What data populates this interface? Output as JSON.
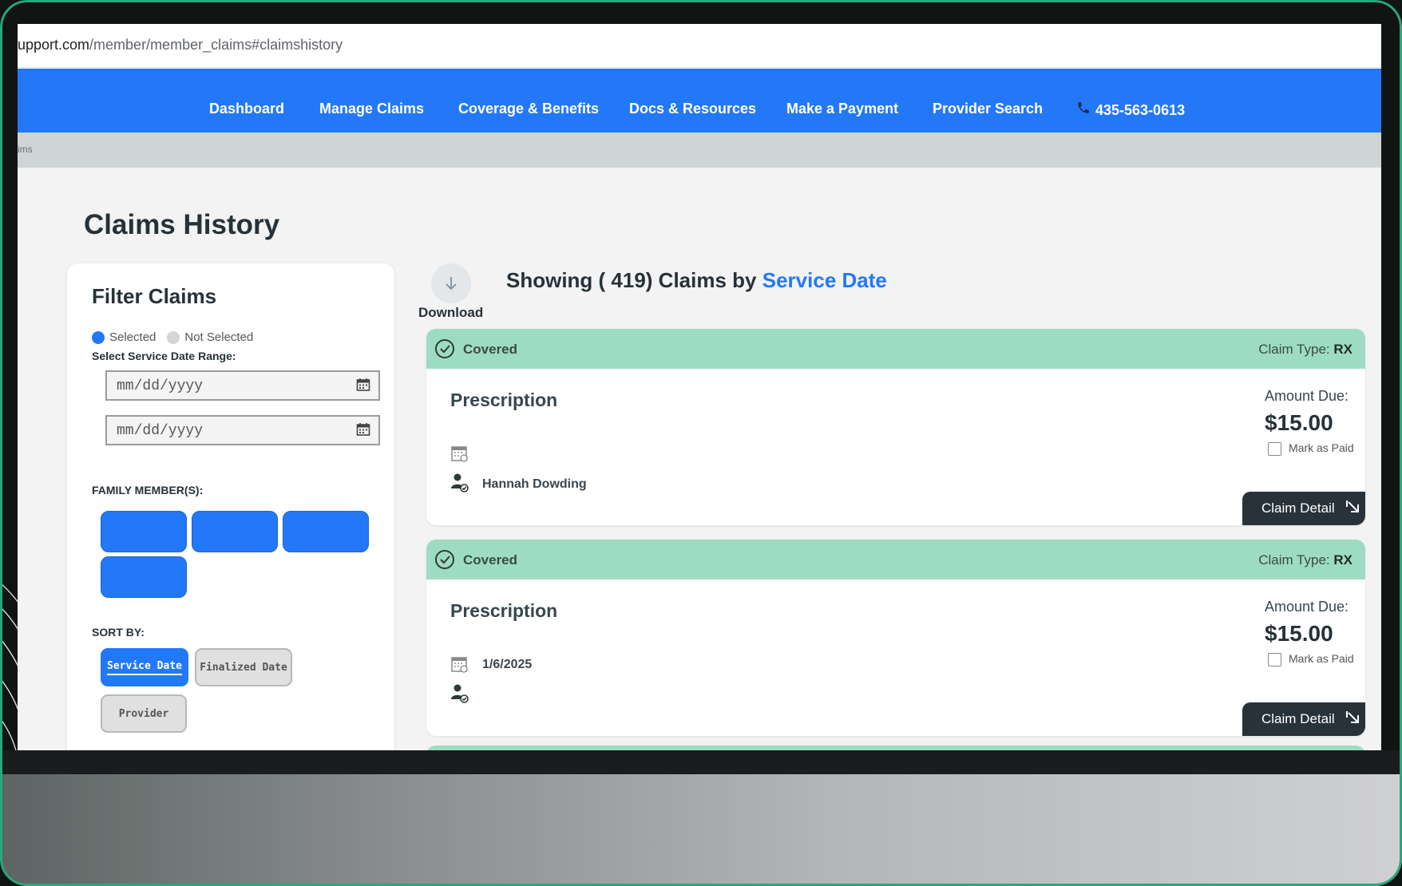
{
  "browser": {
    "url_domain": "upport.com",
    "url_path": "/member/member_claims#claimshistory"
  },
  "nav": {
    "items": [
      "Dashboard",
      "Manage Claims",
      "Coverage & Benefits",
      "Docs & Resources",
      "Make a Payment",
      "Provider Search"
    ],
    "phone": "435-563-0613"
  },
  "breadcrumb": "ims",
  "page_title": "Claims History",
  "filter": {
    "title": "Filter Claims",
    "legend_selected": "Selected",
    "legend_not_selected": "Not Selected",
    "date_range_label": "Select Service Date Range:",
    "date_start_placeholder": "mm/dd/yyyy",
    "date_end_placeholder": "mm/dd/yyyy",
    "family_label": "FAMILY MEMBER(S):",
    "sort_label": "SORT BY:",
    "sort_options": [
      "Service Date",
      "Finalized Date",
      "Provider"
    ],
    "sort_selected": "Service Date"
  },
  "results": {
    "download_label": "Download",
    "showing_prefix": "Showing ( 419) Claims by",
    "showing_sort": "Service Date",
    "claims": [
      {
        "status": "Covered",
        "claim_type_label": "Claim Type:",
        "claim_type": "RX",
        "title": "Prescription",
        "date": "",
        "member": "Hannah Dowding",
        "amount_label": "Amount Due:",
        "amount": "$15.00",
        "mark_paid": "Mark as Paid",
        "detail_label": "Claim Detail"
      },
      {
        "status": "Covered",
        "claim_type_label": "Claim Type:",
        "claim_type": "RX",
        "title": "Prescription",
        "date": "1/6/2025",
        "member": "",
        "amount_label": "Amount Due:",
        "amount": "$15.00",
        "mark_paid": "Mark as Paid",
        "detail_label": "Claim Detail"
      }
    ]
  },
  "colors": {
    "accent": "#2378f8",
    "covered": "#9ddcc3",
    "detail_button": "#27323b"
  }
}
